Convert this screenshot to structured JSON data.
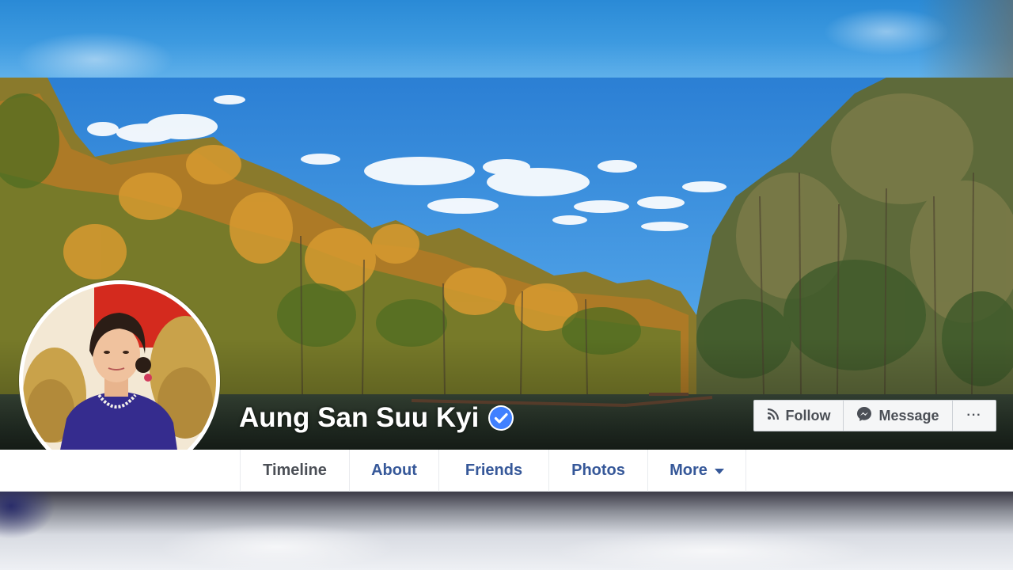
{
  "page": {
    "name": "Aung San Suu Kyi",
    "verified": true
  },
  "icons": {
    "verified": "verified-badge-icon",
    "follow": "rss-follow-icon",
    "message": "messenger-icon",
    "more": "ellipsis-icon",
    "dropdown": "caret-down-icon"
  },
  "actions": {
    "follow_label": "Follow",
    "message_label": "Message",
    "more_label": "···"
  },
  "tabs": [
    {
      "label": "Timeline",
      "active": true
    },
    {
      "label": "About",
      "active": false
    },
    {
      "label": "Friends",
      "active": false
    },
    {
      "label": "Photos",
      "active": false
    },
    {
      "label": "More",
      "active": false,
      "dropdown": true
    }
  ],
  "colors": {
    "link_blue": "#365899",
    "verified_blue": "#4080ff",
    "tab_active": "#4b4f56"
  }
}
